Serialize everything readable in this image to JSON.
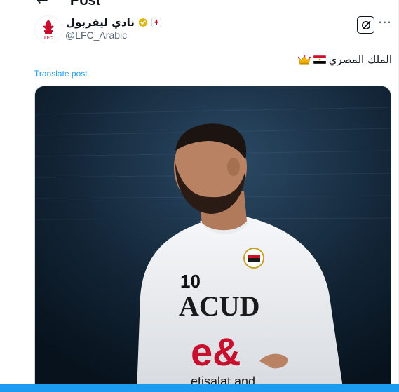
{
  "header": {
    "back_glyph": "←",
    "title": "Post"
  },
  "author": {
    "display_name": "نادي ليفربول",
    "handle": "@LFC_Arabic",
    "avatar_icon": "lfc-crest-icon",
    "verified_color": "#e2b719",
    "affiliate_badge_icon": "lfc-mini-crest-icon"
  },
  "actions": {
    "grok_icon": "grok-slash-icon",
    "more_label": "···"
  },
  "post": {
    "text": "الملك المصري",
    "emoji": [
      "flag-egypt-icon",
      "crown-icon"
    ],
    "translate_label": "Translate post"
  },
  "media": {
    "description_icon": "player-photo",
    "jersey_number": "10",
    "sponsor_text": "ACUD",
    "brand_text": "e&",
    "brand_sub": "etisalat and"
  },
  "colors": {
    "link": "#1d9bf0",
    "lfc_red": "#c8102e",
    "muted": "#536471"
  }
}
